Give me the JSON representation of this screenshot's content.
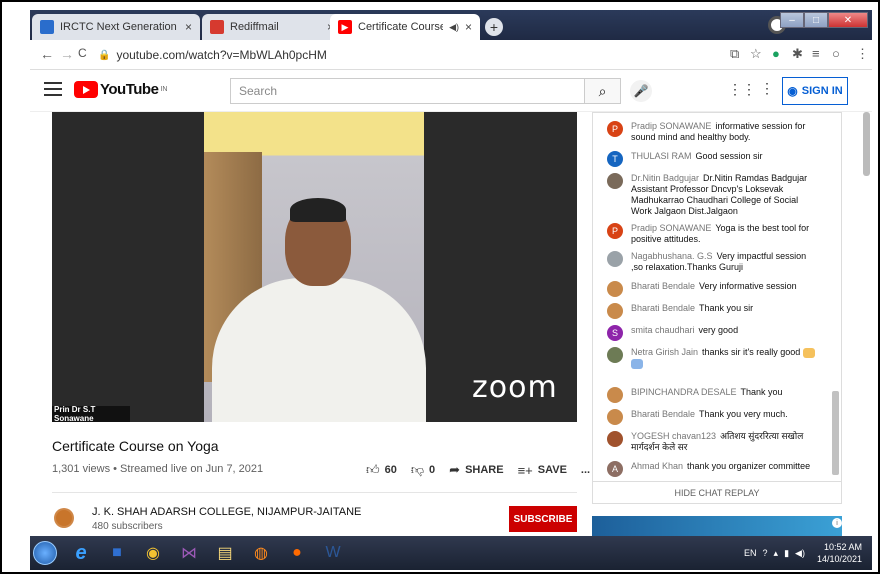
{
  "browser": {
    "tabs": [
      {
        "title": "IRCTC Next Generation eTicketin",
        "close": "×",
        "color": "#2a6dcc"
      },
      {
        "title": "Rediffmail",
        "close": "×",
        "color": "#d63a2f"
      },
      {
        "title": "Certificate Course on Yoga -",
        "close": "×",
        "color": "#ff0000"
      }
    ],
    "new_tab": "+",
    "url": "youtube.com/watch?v=MbWLAh0pcHM",
    "nav_back": "←",
    "nav_forward": "→",
    "nav_reload": "C"
  },
  "youtube": {
    "logo_word": "YouTube",
    "logo_region": "IN",
    "search_placeholder": "Search",
    "sign_in": "SIGN IN"
  },
  "video": {
    "zoom_watermark": "zoom",
    "speaker_tag": "Prin Dr S.T Sonawane",
    "title": "Certificate Course on Yoga",
    "meta": "1,301 views • Streamed live on Jun 7, 2021",
    "likes": "60",
    "dislikes": "0",
    "share": "SHARE",
    "save": "SAVE",
    "more": "..."
  },
  "channel": {
    "name": "J. K. SHAH ADARSH COLLEGE, NIJAMPUR-JAITANE",
    "subscribers": "480 subscribers",
    "subscribe": "SUBSCRIBE"
  },
  "chat": {
    "messages": [
      {
        "initial": "P",
        "color": "#d84315",
        "author": "Pradip SONAWANE",
        "text": "informative session for sound mind and healthy body."
      },
      {
        "initial": "T",
        "color": "#1565c0",
        "author": "THULASI RAM",
        "text": "Good session sir"
      },
      {
        "initial": "",
        "color": "#7a6a5a",
        "author": "Dr.Nitin Badgujar",
        "text": "Dr.Nitin Ramdas Badgujar Assistant Professor Dncvp's Loksevak Madhukarrao Chaudhari College of Social Work Jalgaon Dist.Jalgaon"
      },
      {
        "initial": "P",
        "color": "#d84315",
        "author": "Pradip SONAWANE",
        "text": "Yoga is the best tool for positive attitudes."
      },
      {
        "initial": "",
        "color": "#9aa2a8",
        "author": "Nagabhushana. G.S",
        "text": "Very impactful session ,so relaxation.Thanks Guruji"
      },
      {
        "initial": "",
        "color": "#c98a4b",
        "author": "Bharati Bendale",
        "text": "Very informative session"
      },
      {
        "initial": "",
        "color": "#c98a4b",
        "author": "Bharati Bendale",
        "text": "Thank you sir"
      },
      {
        "initial": "S",
        "color": "#8e24aa",
        "author": "smita chaudhari",
        "text": "very good"
      },
      {
        "initial": "",
        "color": "#6d7b55",
        "author": "Netra Girish Jain",
        "text": "thanks sir it's really good"
      },
      {
        "initial": "",
        "color": "#c98a4b",
        "author": "BIPINCHANDRA DESALE",
        "text": "Thank you"
      },
      {
        "initial": "",
        "color": "#c98a4b",
        "author": "Bharati Bendale",
        "text": "Thank you very much."
      },
      {
        "initial": "",
        "color": "#a0522d",
        "author": "YOGESH chavan123",
        "text": "अतिशय सुंदररित्या सखोल मार्गदर्शन केले सर"
      },
      {
        "initial": "A",
        "color": "#8d6e63",
        "author": "Ahmad Khan",
        "text": "thank you organizer committee"
      }
    ],
    "hide_replay": "HIDE CHAT REPLAY"
  },
  "taskbar": {
    "lang": "EN",
    "time": "10:52 AM",
    "date": "14/10/2021"
  }
}
